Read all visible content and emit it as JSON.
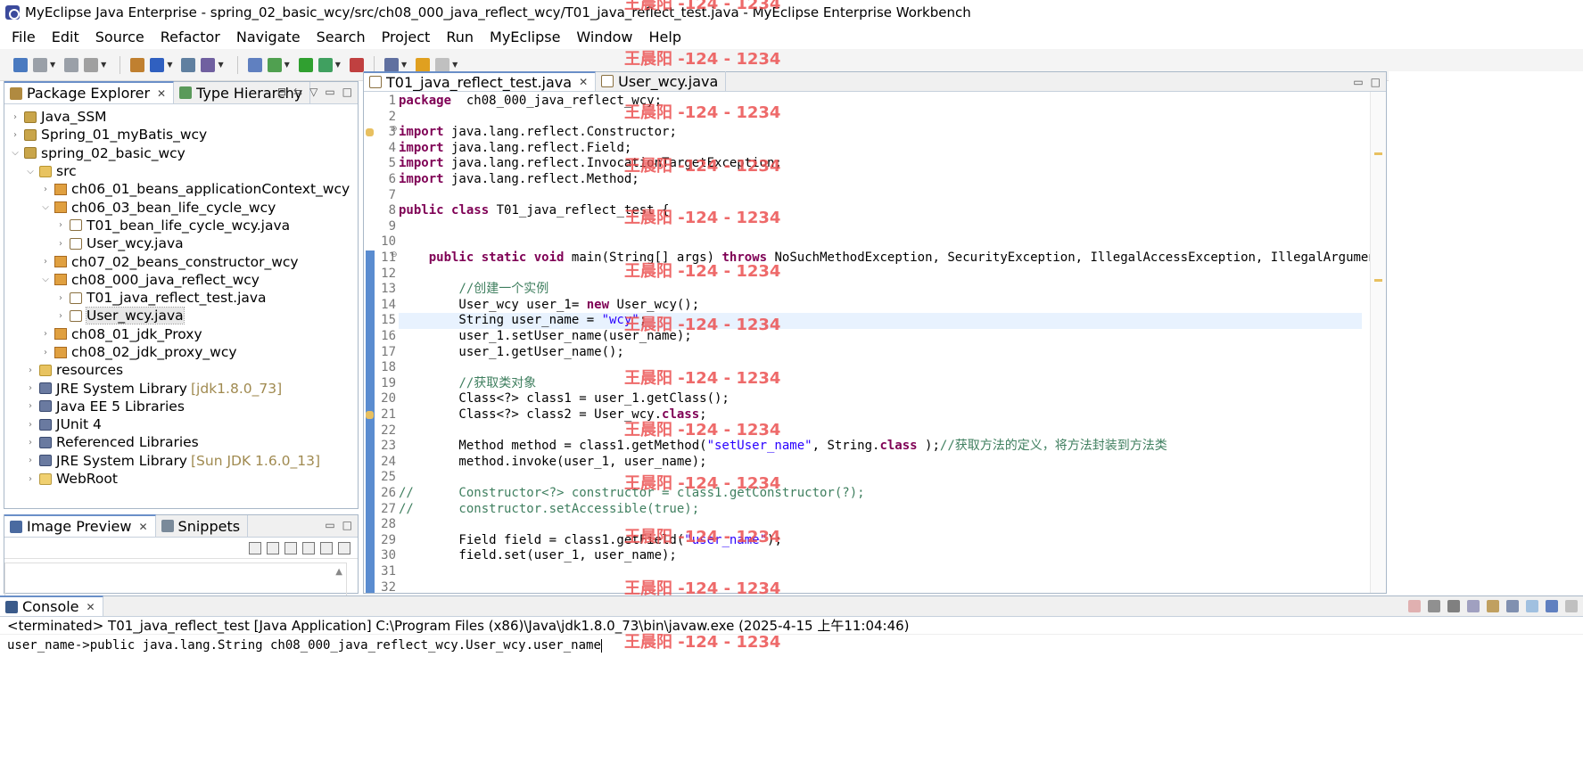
{
  "window": {
    "title": "MyEclipse Java Enterprise - spring_02_basic_wcy/src/ch08_000_java_reflect_wcy/T01_java_reflect_test.java - MyEclipse Enterprise Workbench"
  },
  "menubar": {
    "items": [
      "File",
      "Edit",
      "Source",
      "Refactor",
      "Navigate",
      "Search",
      "Project",
      "Run",
      "MyEclipse",
      "Window",
      "Help"
    ]
  },
  "toolbar": {
    "icons": [
      "new-icon",
      "save-icon",
      "save-all-icon",
      "print-icon",
      "new-project-icon",
      "open-type-icon",
      "server-icon",
      "deploy-icon",
      "search-icon",
      "debug-icon",
      "run-icon",
      "run-external-icon",
      "external-tools-icon",
      "open-perspective-icon",
      "back-icon",
      "forward-icon"
    ]
  },
  "package_explorer": {
    "tabs": [
      {
        "label": "Package Explorer",
        "active": true
      },
      {
        "label": "Type Hierarchy",
        "active": false
      }
    ],
    "tree": [
      {
        "label": "Java_SSM",
        "type": "project",
        "depth": 0,
        "expanded": false
      },
      {
        "label": "Spring_01_myBatis_wcy",
        "type": "project",
        "depth": 0,
        "expanded": false
      },
      {
        "label": "spring_02_basic_wcy",
        "type": "project",
        "depth": 0,
        "expanded": true
      },
      {
        "label": "src",
        "type": "src",
        "depth": 1,
        "expanded": true
      },
      {
        "label": "ch06_01_beans_applicationContext_wcy",
        "type": "pkg",
        "depth": 2,
        "expanded": false
      },
      {
        "label": "ch06_03_bean_life_cycle_wcy",
        "type": "pkg",
        "depth": 2,
        "expanded": true
      },
      {
        "label": "T01_bean_life_cycle_wcy.java",
        "type": "java",
        "depth": 3,
        "expanded": false
      },
      {
        "label": "User_wcy.java",
        "type": "java",
        "depth": 3,
        "expanded": false
      },
      {
        "label": "ch07_02_beans_constructor_wcy",
        "type": "pkg",
        "depth": 2,
        "expanded": false
      },
      {
        "label": "ch08_000_java_reflect_wcy",
        "type": "pkg",
        "depth": 2,
        "expanded": true
      },
      {
        "label": "T01_java_reflect_test.java",
        "type": "java",
        "depth": 3,
        "expanded": false
      },
      {
        "label": "User_wcy.java",
        "type": "java",
        "depth": 3,
        "expanded": false,
        "selected": true
      },
      {
        "label": "ch08_01_jdk_Proxy",
        "type": "pkg",
        "depth": 2,
        "expanded": false
      },
      {
        "label": "ch08_02_jdk_proxy_wcy",
        "type": "pkg",
        "depth": 2,
        "expanded": false
      },
      {
        "label": "resources",
        "type": "src",
        "depth": 1,
        "expanded": false
      },
      {
        "label": "JRE System Library",
        "decoration": "[jdk1.8.0_73]",
        "type": "lib",
        "depth": 1,
        "expanded": false
      },
      {
        "label": "Java EE 5 Libraries",
        "type": "lib",
        "depth": 1,
        "expanded": false
      },
      {
        "label": "JUnit 4",
        "type": "lib",
        "depth": 1,
        "expanded": false
      },
      {
        "label": "Referenced Libraries",
        "type": "lib",
        "depth": 1,
        "expanded": false
      },
      {
        "label": "JRE System Library",
        "decoration": "[Sun JDK 1.6.0_13]",
        "type": "lib",
        "depth": 1,
        "expanded": false
      },
      {
        "label": "WebRoot",
        "type": "folder",
        "depth": 1,
        "expanded": false
      }
    ]
  },
  "image_preview": {
    "tabs": [
      {
        "label": "Image Preview",
        "active": true
      },
      {
        "label": "Snippets",
        "active": false
      }
    ]
  },
  "editor": {
    "tabs": [
      {
        "label": "T01_java_reflect_test.java",
        "active": true
      },
      {
        "label": "User_wcy.java",
        "active": false
      }
    ],
    "current_line": 15,
    "lines": [
      {
        "n": "1",
        "tokens": [
          [
            "kw",
            "package"
          ],
          [
            "",
            "  ch08_000_java_reflect_wcy;"
          ]
        ]
      },
      {
        "n": "2",
        "tokens": []
      },
      {
        "n": "3",
        "tokens": [
          [
            "kw",
            "import"
          ],
          [
            "",
            " java.lang.reflect.Constructor;"
          ]
        ],
        "marker": "warning",
        "fold": true
      },
      {
        "n": "4",
        "tokens": [
          [
            "kw",
            "import"
          ],
          [
            "",
            " java.lang.reflect.Field;"
          ]
        ]
      },
      {
        "n": "5",
        "tokens": [
          [
            "kw",
            "import"
          ],
          [
            "",
            " java.lang.reflect.InvocationTargetException;"
          ]
        ]
      },
      {
        "n": "6",
        "tokens": [
          [
            "kw",
            "import"
          ],
          [
            "",
            " java.lang.reflect.Method;"
          ]
        ]
      },
      {
        "n": "7",
        "tokens": []
      },
      {
        "n": "8",
        "tokens": [
          [
            "kw",
            "public"
          ],
          [
            "",
            " "
          ],
          [
            "kw",
            "class"
          ],
          [
            "",
            " T01_java_reflect_test {"
          ]
        ]
      },
      {
        "n": "9",
        "tokens": []
      },
      {
        "n": "10",
        "tokens": []
      },
      {
        "n": "11",
        "tokens": [
          [
            "",
            "    "
          ],
          [
            "kw",
            "public"
          ],
          [
            "",
            " "
          ],
          [
            "kw",
            "static"
          ],
          [
            "",
            " "
          ],
          [
            "kw",
            "void"
          ],
          [
            "",
            " main(String[] args) "
          ],
          [
            "kw",
            "throws"
          ],
          [
            "",
            " NoSuchMethodException, SecurityException, IllegalAccessException, IllegalArgumentExcep"
          ]
        ],
        "fold": true
      },
      {
        "n": "12",
        "tokens": []
      },
      {
        "n": "13",
        "tokens": [
          [
            "",
            "        "
          ],
          [
            "cm",
            "//创建一个实例"
          ]
        ]
      },
      {
        "n": "14",
        "tokens": [
          [
            "",
            "        User_wcy user_1= "
          ],
          [
            "kw",
            "new"
          ],
          [
            "",
            " User_wcy();"
          ]
        ]
      },
      {
        "n": "15",
        "tokens": [
          [
            "",
            "        String user_name = "
          ],
          [
            "st",
            "\"wcy\""
          ],
          [
            "",
            ";"
          ]
        ]
      },
      {
        "n": "16",
        "tokens": [
          [
            "",
            "        user_1.setUser_name(user_name);"
          ]
        ]
      },
      {
        "n": "17",
        "tokens": [
          [
            "",
            "        user_1.getUser_name();"
          ]
        ]
      },
      {
        "n": "18",
        "tokens": []
      },
      {
        "n": "19",
        "tokens": [
          [
            "",
            "        "
          ],
          [
            "cm",
            "//获取类对象"
          ]
        ]
      },
      {
        "n": "20",
        "tokens": [
          [
            "",
            "        Class<?> class1 = user_1.getClass();"
          ]
        ]
      },
      {
        "n": "21",
        "tokens": [
          [
            "",
            "        Class<?> class2 = User_wcy."
          ],
          [
            "kw",
            "class"
          ],
          [
            "",
            ";"
          ]
        ],
        "marker": "warning"
      },
      {
        "n": "22",
        "tokens": []
      },
      {
        "n": "23",
        "tokens": [
          [
            "",
            "        Method method = class1.getMethod("
          ],
          [
            "st",
            "\"setUser_name\""
          ],
          [
            "",
            ", String."
          ],
          [
            "kw",
            "class"
          ],
          [
            "",
            " );"
          ],
          [
            "cm",
            "//获取方法的定义，将方法封装到方法类"
          ]
        ]
      },
      {
        "n": "24",
        "tokens": [
          [
            "",
            "        method.invoke(user_1, user_name);"
          ]
        ]
      },
      {
        "n": "25",
        "tokens": []
      },
      {
        "n": "26",
        "tokens": [
          [
            "cm",
            "//      Constructor<?> constructor = class1.getConstructor(?);"
          ]
        ]
      },
      {
        "n": "27",
        "tokens": [
          [
            "cm",
            "//      constructor.setAccessible(true);"
          ]
        ]
      },
      {
        "n": "28",
        "tokens": []
      },
      {
        "n": "29",
        "tokens": [
          [
            "",
            "        Field field = class1.getField("
          ],
          [
            "st",
            "\"user_name\""
          ],
          [
            "",
            ");"
          ]
        ]
      },
      {
        "n": "30",
        "tokens": [
          [
            "",
            "        field.set(user_1, user_name);"
          ]
        ]
      },
      {
        "n": "31",
        "tokens": []
      },
      {
        "n": "32",
        "tokens": []
      }
    ]
  },
  "console": {
    "tab_label": "Console",
    "status": "<terminated> T01_java_reflect_test [Java Application] C:\\Program Files (x86)\\Java\\jdk1.8.0_73\\bin\\javaw.exe (2025-4-15 上午11:04:46)",
    "output": "user_name->public java.lang.String ch08_000_java_reflect_wcy.User_wcy.user_name"
  },
  "watermark": {
    "text": "王晨阳 -124 - 1234"
  },
  "colors": {
    "keyword": "#7f0055",
    "comment": "#3f7f5f",
    "string": "#2a00ff",
    "current_line": "#e8f2fe",
    "watermark": "#eb5050"
  }
}
